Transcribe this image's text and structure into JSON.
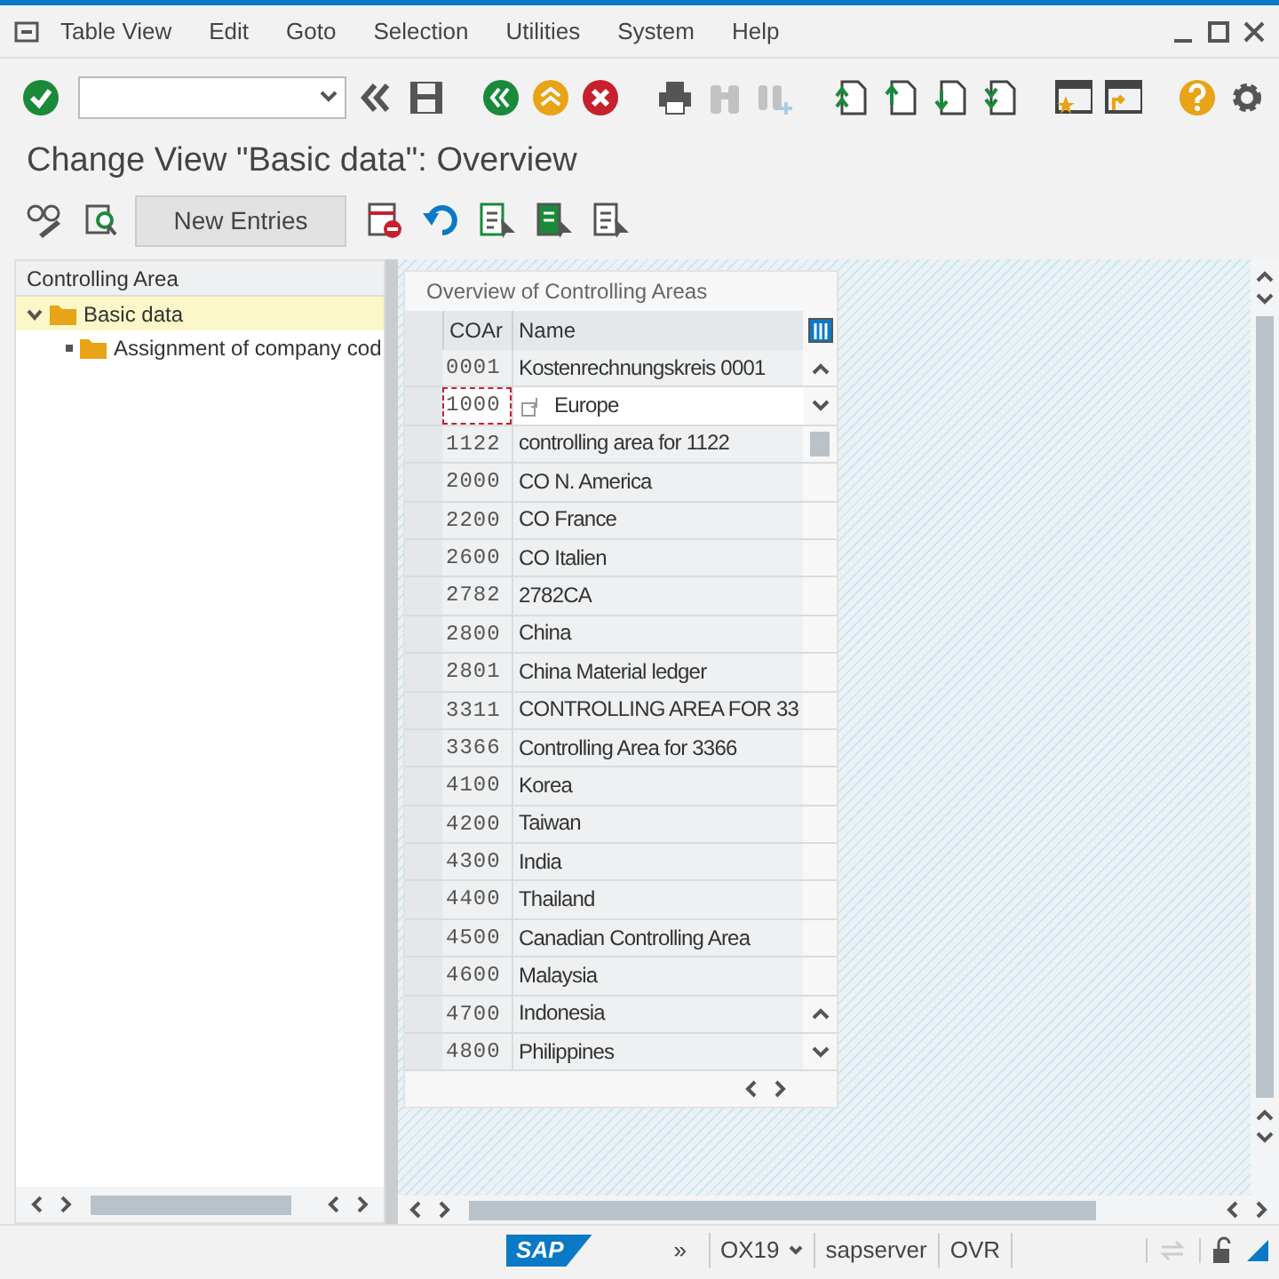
{
  "menu_bar": {
    "items": [
      "Table View",
      "Edit",
      "Goto",
      "Selection",
      "Utilities",
      "System",
      "Help"
    ]
  },
  "toolbar": {
    "buttons": [
      {
        "kind": "enter",
        "disabled": false
      },
      {
        "kind": "back-history",
        "disabled": false
      },
      {
        "kind": "save",
        "disabled": false
      },
      {
        "kind": "back",
        "disabled": false
      },
      {
        "kind": "exit",
        "disabled": false
      },
      {
        "kind": "cancel",
        "disabled": false
      },
      {
        "kind": "print",
        "disabled": false
      },
      {
        "kind": "find",
        "disabled": true
      },
      {
        "kind": "find-next",
        "disabled": true
      },
      {
        "kind": "first-page",
        "disabled": false
      },
      {
        "kind": "prev-page",
        "disabled": false
      },
      {
        "kind": "next-page",
        "disabled": false
      },
      {
        "kind": "last-page",
        "disabled": false
      },
      {
        "kind": "new-session",
        "disabled": false
      },
      {
        "kind": "shortcut",
        "disabled": false
      },
      {
        "kind": "help",
        "disabled": false
      },
      {
        "kind": "settings",
        "disabled": false
      }
    ]
  },
  "title": "Change View \"Basic data\": Overview",
  "app_toolbar": {
    "new_entries": "New Entries"
  },
  "tree": {
    "header": "Controlling Area",
    "items": [
      {
        "label": "Basic data",
        "selected": true,
        "expanded": true,
        "children": [
          {
            "label": "Assignment of company cod",
            "selected": false
          }
        ]
      }
    ]
  },
  "table": {
    "title": "Overview of Controlling Areas",
    "columns": [
      "COAr",
      "Name"
    ],
    "rows": [
      {
        "coar": "0001",
        "name": "Kostenrechnungskreis 0001",
        "focused": false
      },
      {
        "coar": "1000",
        "name": "Europe",
        "focused": true
      },
      {
        "coar": "1122",
        "name": "controlling area for 1122",
        "focused": false
      },
      {
        "coar": "2000",
        "name": "CO N. America",
        "focused": false
      },
      {
        "coar": "2200",
        "name": "CO France",
        "focused": false
      },
      {
        "coar": "2600",
        "name": "CO Italien",
        "focused": false
      },
      {
        "coar": "2782",
        "name": "2782CA",
        "focused": false
      },
      {
        "coar": "2800",
        "name": "China",
        "focused": false
      },
      {
        "coar": "2801",
        "name": "China Material ledger",
        "focused": false
      },
      {
        "coar": "3311",
        "name": "CONTROLLING AREA FOR 33",
        "focused": false
      },
      {
        "coar": "3366",
        "name": "Controlling Area for 3366",
        "focused": false
      },
      {
        "coar": "4100",
        "name": "Korea",
        "focused": false
      },
      {
        "coar": "4200",
        "name": "Taiwan",
        "focused": false
      },
      {
        "coar": "4300",
        "name": "India",
        "focused": false
      },
      {
        "coar": "4400",
        "name": "Thailand",
        "focused": false
      },
      {
        "coar": "4500",
        "name": "Canadian Controlling Area",
        "focused": false
      },
      {
        "coar": "4600",
        "name": "Malaysia",
        "focused": false
      },
      {
        "coar": "4700",
        "name": "Indonesia",
        "focused": false
      },
      {
        "coar": "4800",
        "name": "Philippines",
        "focused": false
      }
    ]
  },
  "status_bar": {
    "logo": "SAP",
    "expand": "»",
    "transaction": "OX19",
    "server": "sapserver",
    "mode": "OVR"
  }
}
